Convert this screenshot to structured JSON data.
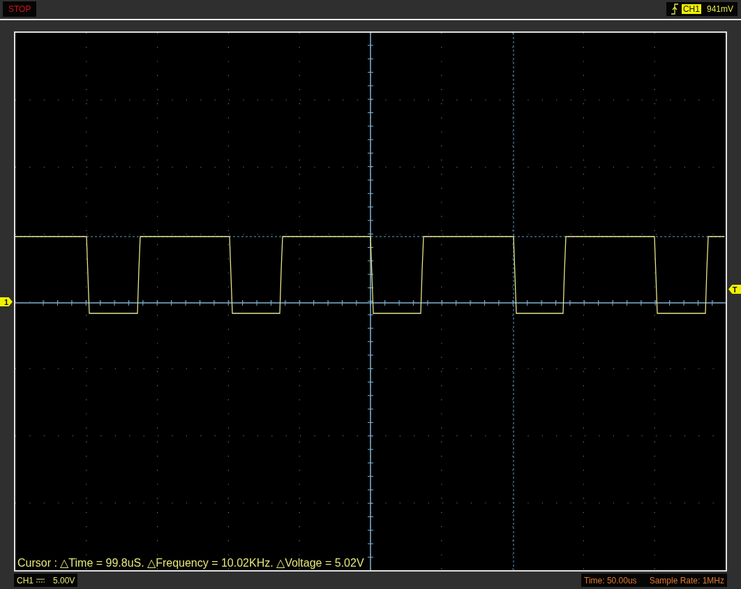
{
  "status": "STOP",
  "trigger": {
    "channel": "CH1",
    "level": "941mV"
  },
  "channel_marker": "1",
  "trigger_marker": "T",
  "cursor_readout": "Cursor : △Time = 99.8uS. △Frequency = 10.02KHz. △Voltage = 5.02V",
  "channel_scale": {
    "channel": "CH1",
    "scale": "5.00V"
  },
  "timebase": {
    "time": "Time: 50.00us",
    "sample_rate": "Sample Rate: 1MHz"
  }
}
